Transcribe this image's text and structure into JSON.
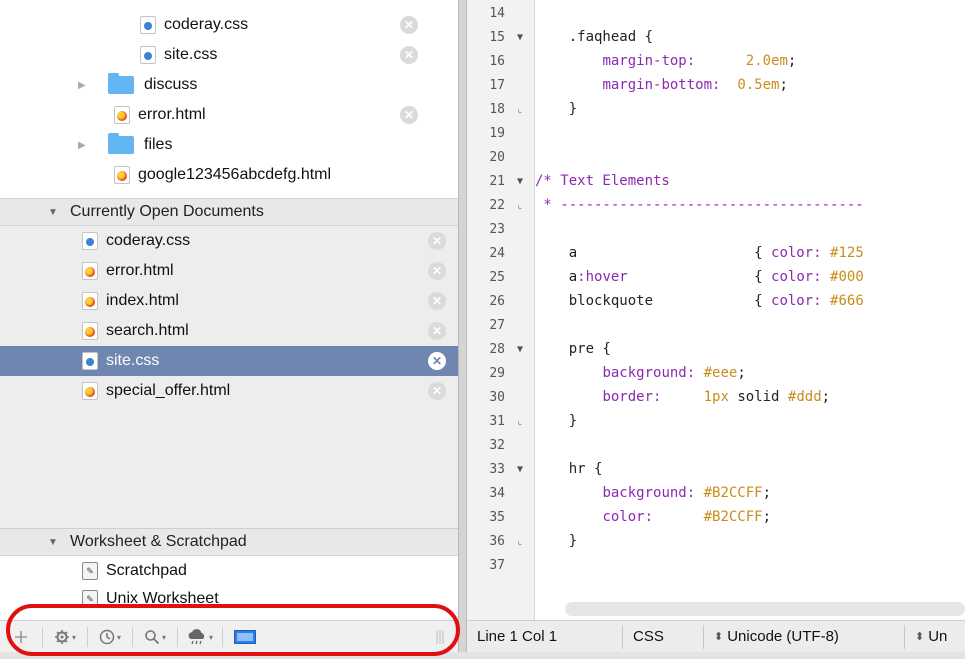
{
  "files_tree": [
    {
      "name": "coderay.css",
      "type": "css",
      "indent": 1,
      "closable": true
    },
    {
      "name": "site.css",
      "type": "css",
      "indent": 1,
      "closable": true
    },
    {
      "name": "discuss",
      "type": "folder",
      "indent": 0,
      "closable": false
    },
    {
      "name": "error.html",
      "type": "html",
      "indent": 0,
      "closable": true
    },
    {
      "name": "files",
      "type": "folder",
      "indent": 0,
      "closable": false
    },
    {
      "name": "google123456abcdefg.html",
      "type": "html",
      "indent": 0,
      "closable": false
    }
  ],
  "open_docs": {
    "header": "Currently Open Documents",
    "items": [
      {
        "name": "coderay.css",
        "type": "css",
        "selected": false
      },
      {
        "name": "error.html",
        "type": "html",
        "selected": false
      },
      {
        "name": "index.html",
        "type": "html",
        "selected": false
      },
      {
        "name": "search.html",
        "type": "html",
        "selected": false
      },
      {
        "name": "site.css",
        "type": "css",
        "selected": true
      },
      {
        "name": "special_offer.html",
        "type": "html",
        "selected": false
      }
    ]
  },
  "worksheets": {
    "header": "Worksheet & Scratchpad",
    "items": [
      {
        "name": "Scratchpad"
      },
      {
        "name": "Unix Worksheet"
      }
    ]
  },
  "editor": {
    "lines": [
      {
        "n": "14",
        "fold": "",
        "html": ""
      },
      {
        "n": "15",
        "fold": "▼",
        "html": "    .faqhead {"
      },
      {
        "n": "16",
        "fold": "",
        "html": "        <span class='tok-prop'>margin-top:</span>      <span class='tok-num'>2.0em</span>;"
      },
      {
        "n": "17",
        "fold": "",
        "html": "        <span class='tok-prop'>margin-bottom:</span>  <span class='tok-num'>0.5em</span>;"
      },
      {
        "n": "18",
        "fold": "⌞",
        "html": "    }"
      },
      {
        "n": "19",
        "fold": "",
        "html": ""
      },
      {
        "n": "20",
        "fold": "",
        "html": ""
      },
      {
        "n": "21",
        "fold": "▼",
        "html": "<span class='tok-comment'>/* Text Elements</span>"
      },
      {
        "n": "22",
        "fold": "⌞",
        "html": "<span class='tok-comment'> * ------------------------------------</span>"
      },
      {
        "n": "23",
        "fold": "",
        "html": ""
      },
      {
        "n": "24",
        "fold": "",
        "html": "    a                     { <span class='tok-prop'>color:</span> <span class='tok-color'>#125</span>"
      },
      {
        "n": "25",
        "fold": "",
        "html": "    a<span class='tok-prop'>:hover</span>               { <span class='tok-prop'>color:</span> <span class='tok-color'>#000</span>"
      },
      {
        "n": "26",
        "fold": "",
        "html": "    blockquote            { <span class='tok-prop'>color:</span> <span class='tok-color'>#666</span>"
      },
      {
        "n": "27",
        "fold": "",
        "html": ""
      },
      {
        "n": "28",
        "fold": "▼",
        "html": "    pre {"
      },
      {
        "n": "29",
        "fold": "",
        "html": "        <span class='tok-prop'>background:</span> <span class='tok-color'>#eee</span>;"
      },
      {
        "n": "30",
        "fold": "",
        "html": "        <span class='tok-prop'>border:</span>     <span class='tok-num'>1px</span> solid <span class='tok-color'>#ddd</span>;"
      },
      {
        "n": "31",
        "fold": "⌞",
        "html": "    }"
      },
      {
        "n": "32",
        "fold": "",
        "html": ""
      },
      {
        "n": "33",
        "fold": "▼",
        "html": "    hr {"
      },
      {
        "n": "34",
        "fold": "",
        "html": "        <span class='tok-prop'>background:</span> <span class='tok-color'>#B2CCFF</span>;"
      },
      {
        "n": "35",
        "fold": "",
        "html": "        <span class='tok-prop'>color:</span>      <span class='tok-color'>#B2CCFF</span>;"
      },
      {
        "n": "36",
        "fold": "⌞",
        "html": "    }"
      },
      {
        "n": "37",
        "fold": "",
        "html": ""
      }
    ]
  },
  "status": {
    "position": "Line 1 Col 1",
    "language": "CSS",
    "encoding": "Unicode (UTF-8)",
    "line_endings": "Un"
  },
  "toolbar": {
    "add_icon": "plus-icon",
    "gear_icon": "gear-icon",
    "clock_icon": "clock-icon",
    "search_icon": "search-icon",
    "cloud_icon": "cloud-icon",
    "layout_icon": "layout-icon",
    "resize_icon": "resize-grip-icon"
  },
  "colors": {
    "selection": "#6f87b0",
    "annotation_oval": "#e01010",
    "folder": "#63b5f4"
  }
}
